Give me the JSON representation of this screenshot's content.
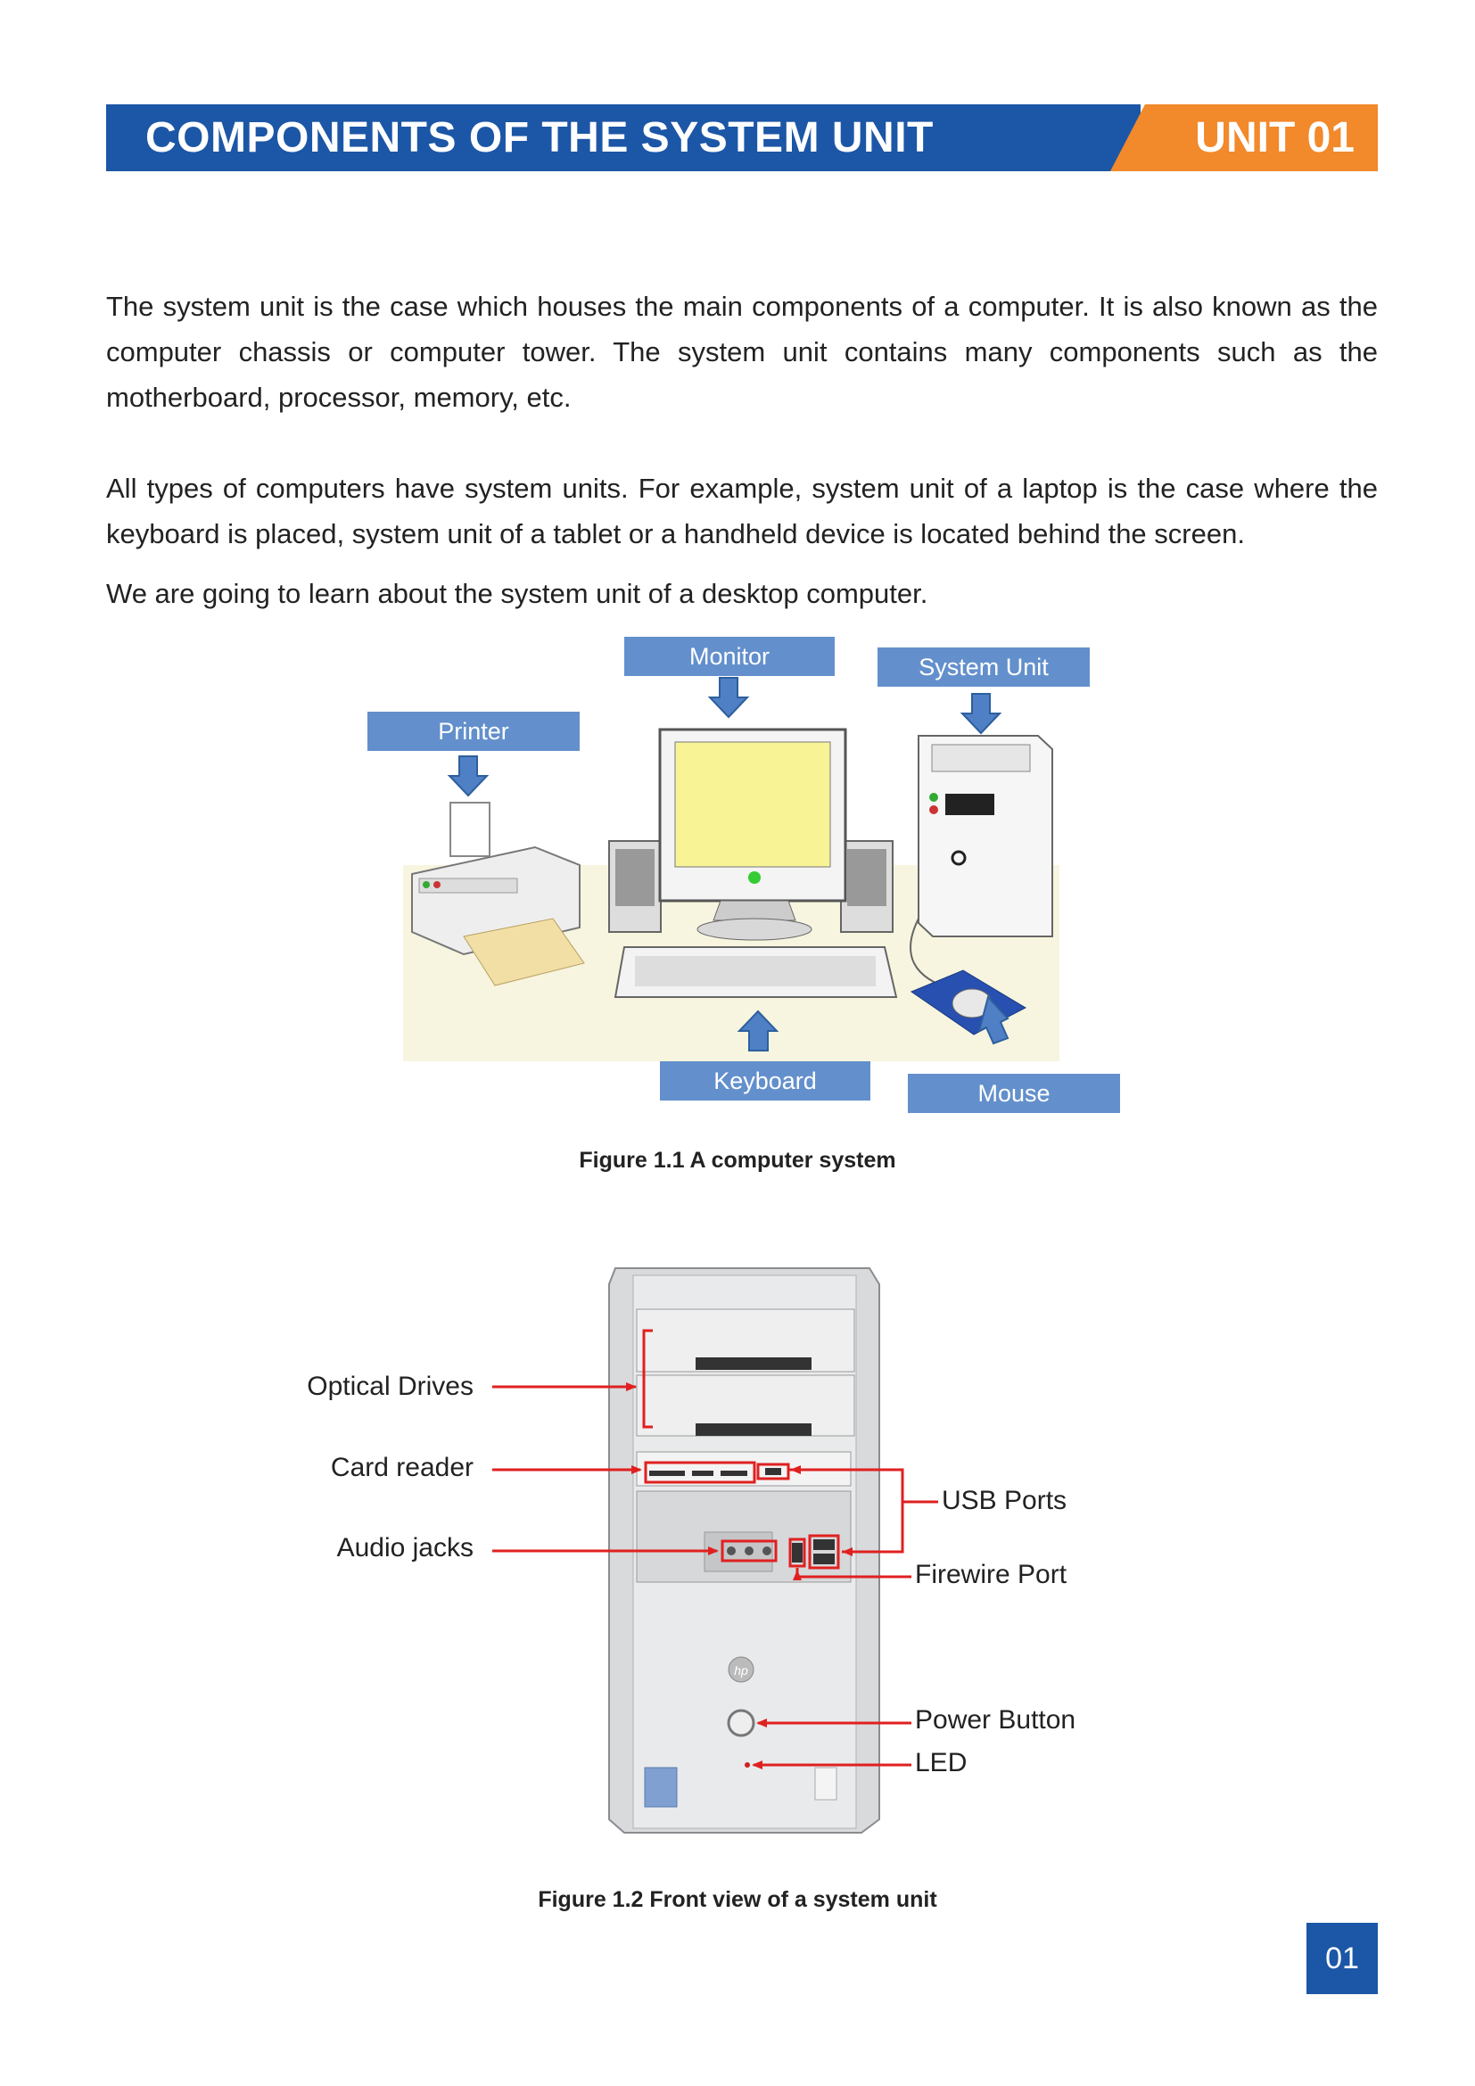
{
  "header": {
    "title": "COMPONENTS OF THE SYSTEM UNIT",
    "unit": "UNIT 01"
  },
  "paragraphs": {
    "p1": "The system unit is the case which houses the main components of a computer. It is also known as the computer chassis or computer tower. The system unit contains many components such as the motherboard, processor, memory, etc.",
    "p2": "All types of computers have system units. For example, system unit of a laptop is the case where the keyboard is placed, system unit of a tablet or a handheld device is located behind the screen.",
    "p3": "We are going to learn about the system unit of a desktop computer."
  },
  "figure1": {
    "labels": {
      "monitor": "Monitor",
      "system_unit": "System Unit",
      "printer": "Printer",
      "keyboard": "Keyboard",
      "mouse": "Mouse"
    },
    "caption": "Figure 1.1 A computer system"
  },
  "figure2": {
    "callouts": {
      "optical_drives": "Optical Drives",
      "card_reader": "Card reader",
      "audio_jacks": "Audio jacks",
      "usb_ports": "USB Ports",
      "firewire_port": "Firewire Port",
      "power_button": "Power Button",
      "led": "LED"
    },
    "caption": "Figure 1.2 Front view of a system unit"
  },
  "page_number": "01",
  "colors": {
    "header_blue": "#1c56a6",
    "header_orange": "#f2892b",
    "label_blue": "#6390cc",
    "callout_red": "#e02020"
  }
}
